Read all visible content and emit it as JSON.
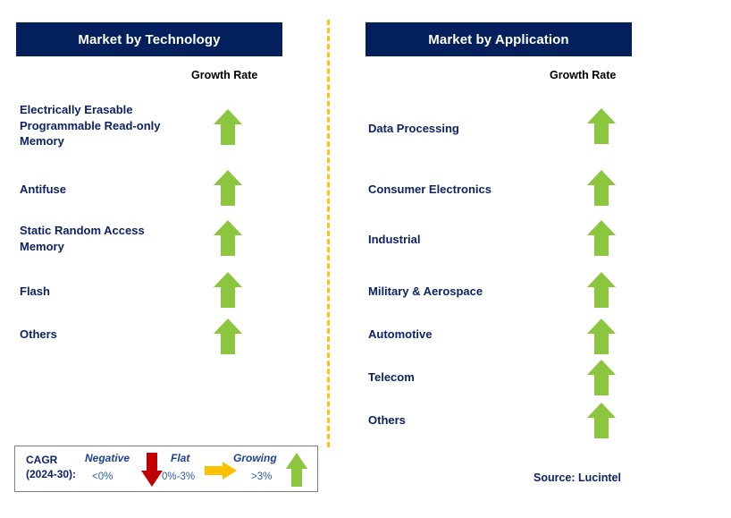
{
  "page": {
    "background_color": "#ffffff",
    "header_color": "#04205c",
    "navy_text_color": "#0d2364",
    "arrow_green": "#8cc63f",
    "arrow_red": "#c00000",
    "arrow_orange": "#ffc000",
    "divider_color": "#ffc20e"
  },
  "columns": [
    {
      "title": "Market by Technology",
      "growth_rate_label": "Growth Rate",
      "rows": [
        {
          "label": "Electrically Erasable Programmable Read-only Memory",
          "trend": "growing",
          "icon": "arrow-up-icon"
        },
        {
          "label": "Antifuse",
          "trend": "growing",
          "icon": "arrow-up-icon"
        },
        {
          "label": "Static Random Access Memory",
          "trend": "growing",
          "icon": "arrow-up-icon"
        },
        {
          "label": "Flash",
          "trend": "growing",
          "icon": "arrow-up-icon"
        },
        {
          "label": "Others",
          "trend": "growing",
          "icon": "arrow-up-icon"
        }
      ]
    },
    {
      "title": "Market by Application",
      "growth_rate_label": "Growth Rate",
      "rows": [
        {
          "label": "Data Processing",
          "trend": "growing",
          "icon": "arrow-up-icon"
        },
        {
          "label": "Consumer Electronics",
          "trend": "growing",
          "icon": "arrow-up-icon"
        },
        {
          "label": "Industrial",
          "trend": "growing",
          "icon": "arrow-up-icon"
        },
        {
          "label": "Military & Aerospace",
          "trend": "growing",
          "icon": "arrow-up-icon"
        },
        {
          "label": "Automotive",
          "trend": "growing",
          "icon": "arrow-up-icon"
        },
        {
          "label": "Telecom",
          "trend": "growing",
          "icon": "arrow-up-icon"
        },
        {
          "label": "Others",
          "trend": "growing",
          "icon": "arrow-up-icon"
        }
      ]
    }
  ],
  "legend": {
    "cagr_line1": "CAGR",
    "cagr_line2": "(2024-30):",
    "items": [
      {
        "title": "Negative",
        "value": "<0%",
        "icon": "arrow-down-icon",
        "color": "#c00000"
      },
      {
        "title": "Flat",
        "value": "0%-3%",
        "icon": "arrow-right-icon",
        "color": "#ffc000"
      },
      {
        "title": "Growing",
        "value": ">3%",
        "icon": "arrow-up-icon",
        "color": "#8cc63f"
      }
    ]
  },
  "source": "Source: Lucintel"
}
